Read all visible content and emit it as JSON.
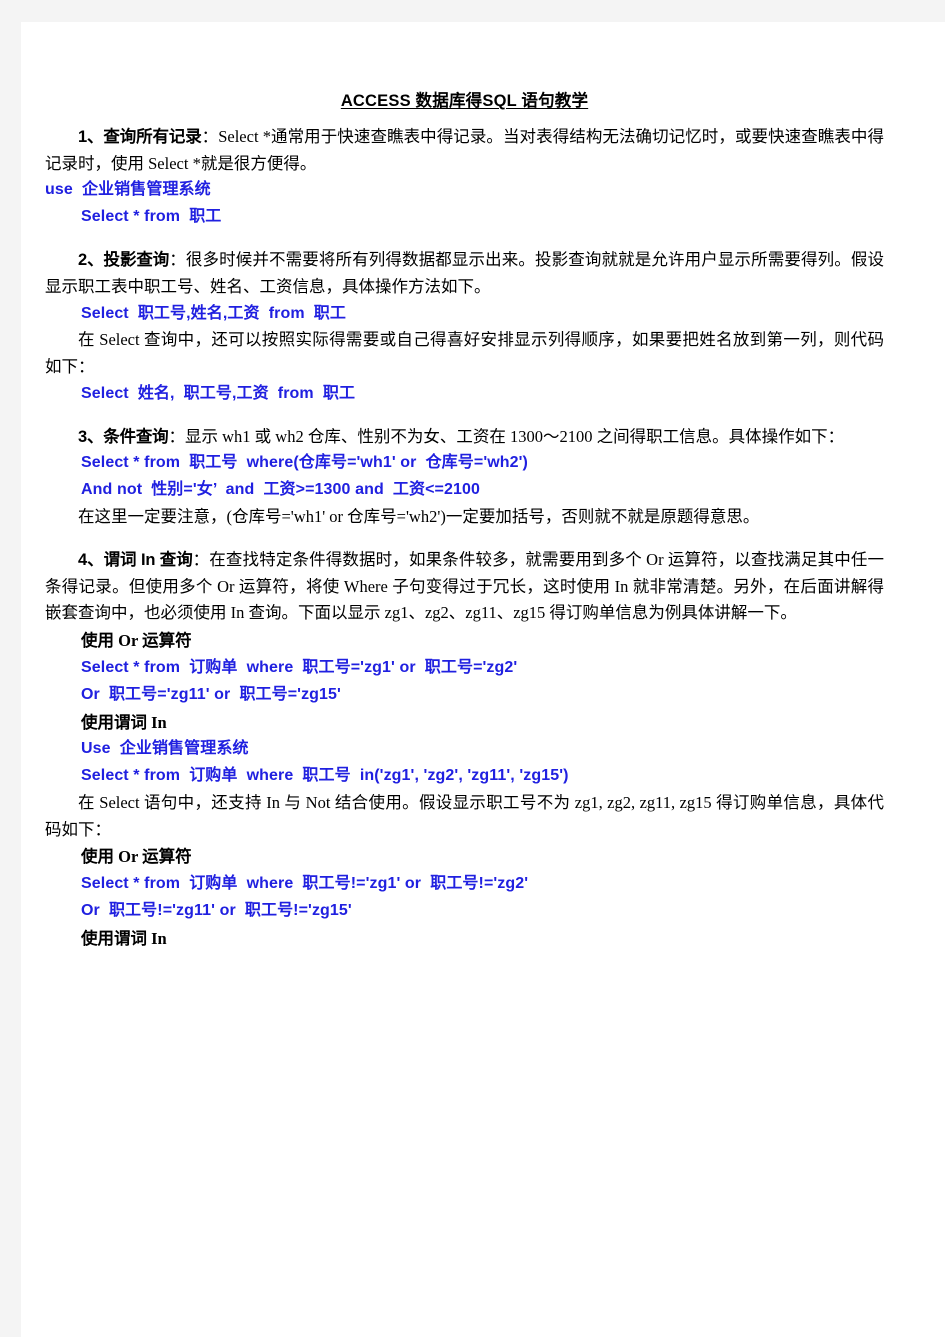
{
  "document": {
    "title_parts": {
      "en1": "ACCESS",
      "cn1": "数据库得",
      "en2": "SQL",
      "cn2": "语句教学"
    },
    "title_full": "ACCESS 数据库得SQL 语句教学",
    "sections": [
      {
        "number": "1、",
        "heading": "查询所有记录",
        "body": "：Select *通常用于快速查瞧表中得记录。当对表得结构无法确切记忆时，或要快速查瞧表中得记录时，使用 Select *就是很方便得。",
        "code_lines": [
          {
            "text": "use  企业销售管理系统",
            "flush": true
          },
          {
            "text": "Select * from  职工",
            "flush": false
          }
        ]
      },
      {
        "number": "2、",
        "heading": "投影查询",
        "body": "：很多时候并不需要将所有列得数据都显示出来。投影查询就就是允许用户显示所需要得列。假设显示职工表中职工号、姓名、工资信息，具体操作方法如下。",
        "code_lines": [
          {
            "text": "Select  职工号,姓名,工资  from  职工",
            "flush": false
          }
        ],
        "body2": "在 Select 查询中，还可以按照实际得需要或自己得喜好安排显示列得顺序，如果要把姓名放到第一列，则代码如下：",
        "code_lines2": [
          {
            "text": "Select  姓名,  职工号,工资  from  职工",
            "flush": false
          }
        ]
      },
      {
        "number": "3、",
        "heading": "条件查询",
        "body": "：显示 wh1 或 wh2 仓库、性别不为女、工资在 1300～2100 之间得职工信息。具体操作如下：",
        "code_lines": [
          {
            "text": "Select * from  职工号  where(仓库号='wh1' or  仓库号='wh2')",
            "flush": false
          },
          {
            "text": "And not  性别='女’  and  工资>=1300 and  工资<=2100",
            "flush": false
          }
        ],
        "body2": "在这里一定要注意，(仓库号='wh1' or 仓库号='wh2')一定要加括号，否则就不就是原题得意思。"
      },
      {
        "number": "4、",
        "heading": "谓词 In 查询",
        "body": "：在查找特定条件得数据时，如果条件较多，就需要用到多个 Or 运算符，以查找满足其中任一条得记录。但使用多个 Or 运算符，将使 Where 子句变得过于冗长，这时使用 In 就非常清楚。另外，在后面讲解得嵌套查询中，也必须使用 In 查询。下面以显示 zg1、zg2、zg11、zg15 得订购单信息为例具体讲解一下。",
        "subhead_1": "使用 Or 运算符",
        "code_lines": [
          {
            "text": "Select * from  订购单  where  职工号='zg1' or  职工号='zg2'",
            "flush": false
          },
          {
            "text": "Or  职工号='zg11' or  职工号='zg15'",
            "flush": false
          }
        ],
        "subhead_2": "使用谓词 In",
        "code_lines2": [
          {
            "text": "Use  企业销售管理系统",
            "flush": false
          },
          {
            "text": "Select * from  订购单  where  职工号  in('zg1', 'zg2', 'zg11', 'zg15')",
            "flush": false
          }
        ],
        "body2": "在 Select 语句中，还支持 In 与 Not 结合使用。假设显示职工号不为 zg1, zg2, zg11, zg15 得订购单信息，具体代码如下：",
        "subhead_3": "使用 Or 运算符",
        "code_lines3": [
          {
            "text": "Select * from  订购单  where  职工号!='zg1' or  职工号!='zg2'",
            "flush": false
          },
          {
            "text": "Or  职工号!='zg11' or  职工号!='zg15'",
            "flush": false
          }
        ],
        "subhead_4": "使用谓词 In"
      }
    ]
  },
  "colors": {
    "code_blue": "#2020E0",
    "text_black": "#000000",
    "page_background": "#ffffff",
    "canvas_background": "#f4f4f4"
  }
}
